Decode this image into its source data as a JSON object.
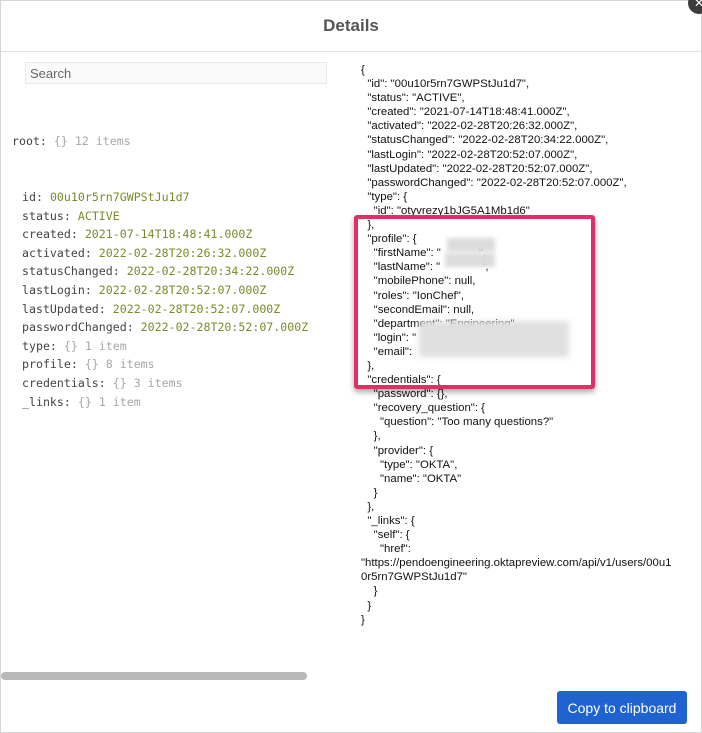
{
  "dialog": {
    "title": "Details",
    "close_glyph": "✕",
    "copy_button_label": "Copy to clipboard"
  },
  "search": {
    "placeholder": "Search"
  },
  "tree": {
    "root": {
      "key": "root:",
      "meta": "{} 12 items"
    },
    "rows": [
      {
        "key": "id:",
        "value": "00u10r5rn7GWPStJu1d7",
        "kind": "str"
      },
      {
        "key": "status:",
        "value": "ACTIVE",
        "kind": "str"
      },
      {
        "key": "created:",
        "value": "2021-07-14T18:48:41.000Z",
        "kind": "str"
      },
      {
        "key": "activated:",
        "value": "2022-02-28T20:26:32.000Z",
        "kind": "str"
      },
      {
        "key": "statusChanged:",
        "value": "2022-02-28T20:34:22.000Z",
        "kind": "str"
      },
      {
        "key": "lastLogin:",
        "value": "2022-02-28T20:52:07.000Z",
        "kind": "str"
      },
      {
        "key": "lastUpdated:",
        "value": "2022-02-28T20:52:07.000Z",
        "kind": "str"
      },
      {
        "key": "passwordChanged:",
        "value": "2022-02-28T20:52:07.000Z",
        "kind": "str"
      },
      {
        "key": "type:",
        "value": "{} 1 item",
        "kind": "meta"
      },
      {
        "key": "profile:",
        "value": "{} 8 items",
        "kind": "meta"
      },
      {
        "key": "credentials:",
        "value": "{} 3 items",
        "kind": "meta"
      },
      {
        "key": "_links:",
        "value": "{} 1 item",
        "kind": "meta"
      }
    ]
  },
  "json_text": "{\n  \"id\": \"00u10r5rn7GWPStJu1d7\",\n  \"status\": \"ACTIVE\",\n  \"created\": \"2021-07-14T18:48:41.000Z\",\n  \"activated\": \"2022-02-28T20:26:32.000Z\",\n  \"statusChanged\": \"2022-02-28T20:34:22.000Z\",\n  \"lastLogin\": \"2022-02-28T20:52:07.000Z\",\n  \"lastUpdated\": \"2022-02-28T20:52:07.000Z\",\n  \"passwordChanged\": \"2022-02-28T20:52:07.000Z\",\n  \"type\": {\n    \"id\": \"otyvrezy1bJG5A1Mb1d6\"\n  },\n  \"profile\": {\n    \"firstName\": \"            \",\n    \"lastName\": \"             \",\n    \"mobilePhone\": null,\n    \"roles\": \"IonChef\",\n    \"secondEmail\": null,\n    \"department\": \"Engineering\",\n    \"login\": \"\n    \"email\": \n  },\n  \"credentials\": {\n    \"password\": {},\n    \"recovery_question\": {\n      \"question\": \"Too many questions?\"\n    },\n    \"provider\": {\n      \"type\": \"OKTA\",\n      \"name\": \"OKTA\"\n    }\n  },\n  \"_links\": {\n    \"self\": {\n      \"href\":\n\"https://pendoengineering.oktapreview.com/api/v1/users/00u1\n0r5rn7GWPStJu1d7\"\n    }\n  }\n}",
  "colors": {
    "accent_button": "#1f63d1",
    "highlight_border": "#e02e66",
    "tree_string": "#7a8a2a",
    "tree_meta": "#a7a7a7"
  }
}
